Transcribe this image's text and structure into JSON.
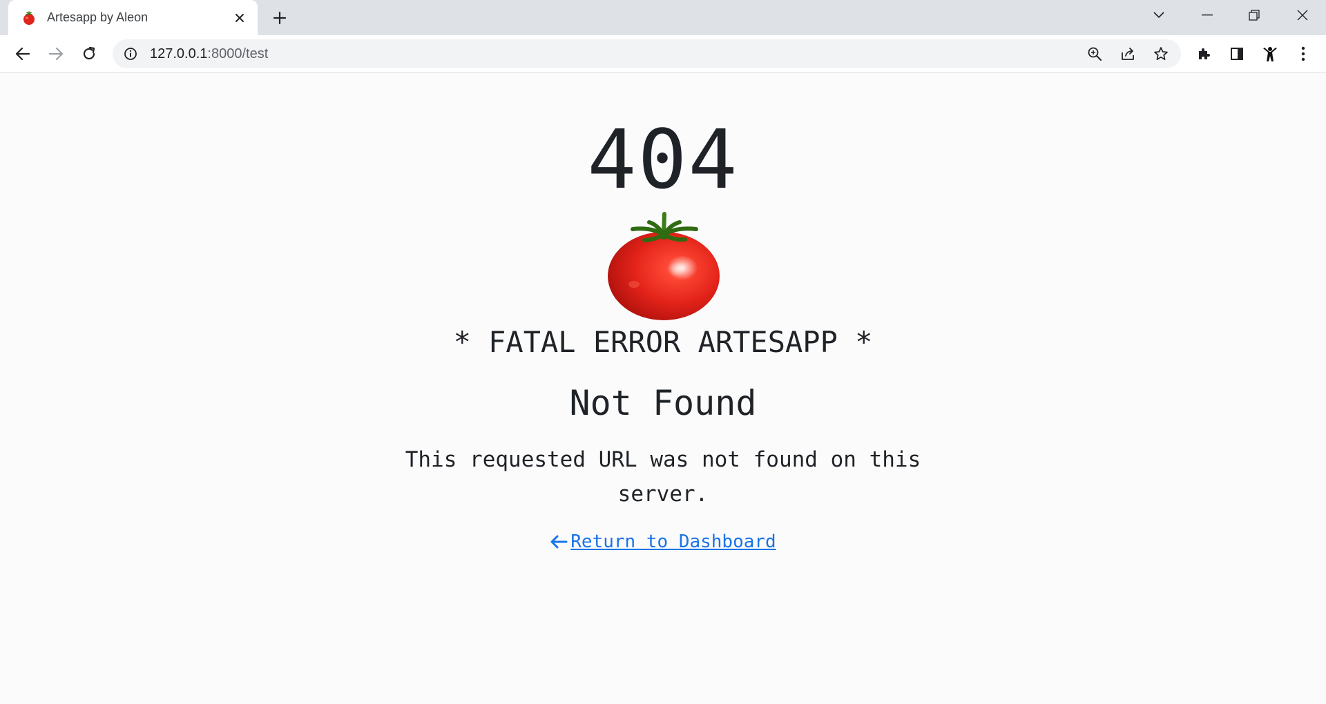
{
  "browser": {
    "tab": {
      "title": "Artesapp by Aleon",
      "favicon": "tomato-icon"
    },
    "address_bar": {
      "host": "127.0.0.1",
      "path": ":8000/test"
    },
    "icons": {
      "back": "back-arrow-icon",
      "forward": "forward-arrow-icon",
      "reload": "reload-icon",
      "site_info": "info-icon",
      "zoom": "zoom-icon",
      "share": "share-icon",
      "bookmark": "star-icon",
      "extensions": "puzzle-icon",
      "side_panel": "side-panel-icon",
      "profile": "profile-icon",
      "menu": "kebab-menu-icon",
      "tab_search": "chevron-down-icon",
      "minimize": "minimize-icon",
      "restore": "restore-icon",
      "close": "close-icon",
      "new_tab": "plus-icon"
    }
  },
  "page": {
    "code": "404",
    "fatal_title": "* FATAL ERROR ARTESAPP *",
    "heading": "Not Found",
    "message": "This requested URL was not found on this server.",
    "return_link": "Return to Dashboard"
  },
  "colors": {
    "link": "#1a73e8",
    "text": "#1f2328",
    "tomato": "#e0231b",
    "background": "#fbfbfb"
  }
}
